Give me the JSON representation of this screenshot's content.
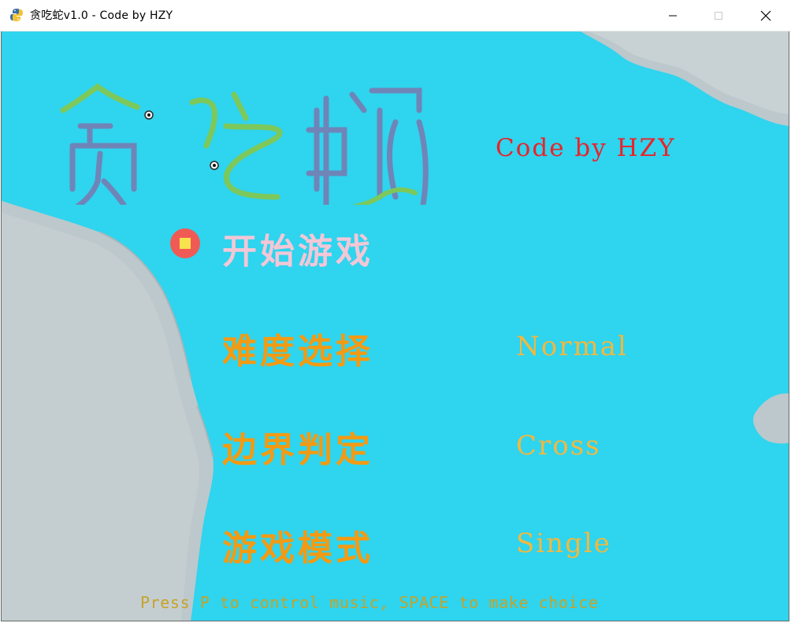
{
  "window": {
    "title": "贪吃蛇v1.0 - Code by HZY",
    "icon": "python-icon",
    "controls": [
      "minimize-icon",
      "maximize-icon",
      "close-icon"
    ]
  },
  "game": {
    "logo_text": "贪吃蛇",
    "credit": "Code by HZY",
    "menu": [
      {
        "label": "开始游戏",
        "value": "",
        "selected": true
      },
      {
        "label": "难度选择",
        "value": "Normal",
        "selected": false
      },
      {
        "label": "边界判定",
        "value": "Cross",
        "selected": false
      },
      {
        "label": "游戏模式",
        "value": "Single",
        "selected": false
      }
    ],
    "hint": "Press P to control music, SPACE to make choice"
  },
  "colors": {
    "sea": "#2fd4ee",
    "land": "#bcc8cc",
    "credit": "#e8242a",
    "menu_selected": "#f3c7d6",
    "menu_normal": "#f39a12",
    "menu_value": "#f2b83e",
    "bullet": "#f05a54",
    "hint": "#c7a227"
  }
}
